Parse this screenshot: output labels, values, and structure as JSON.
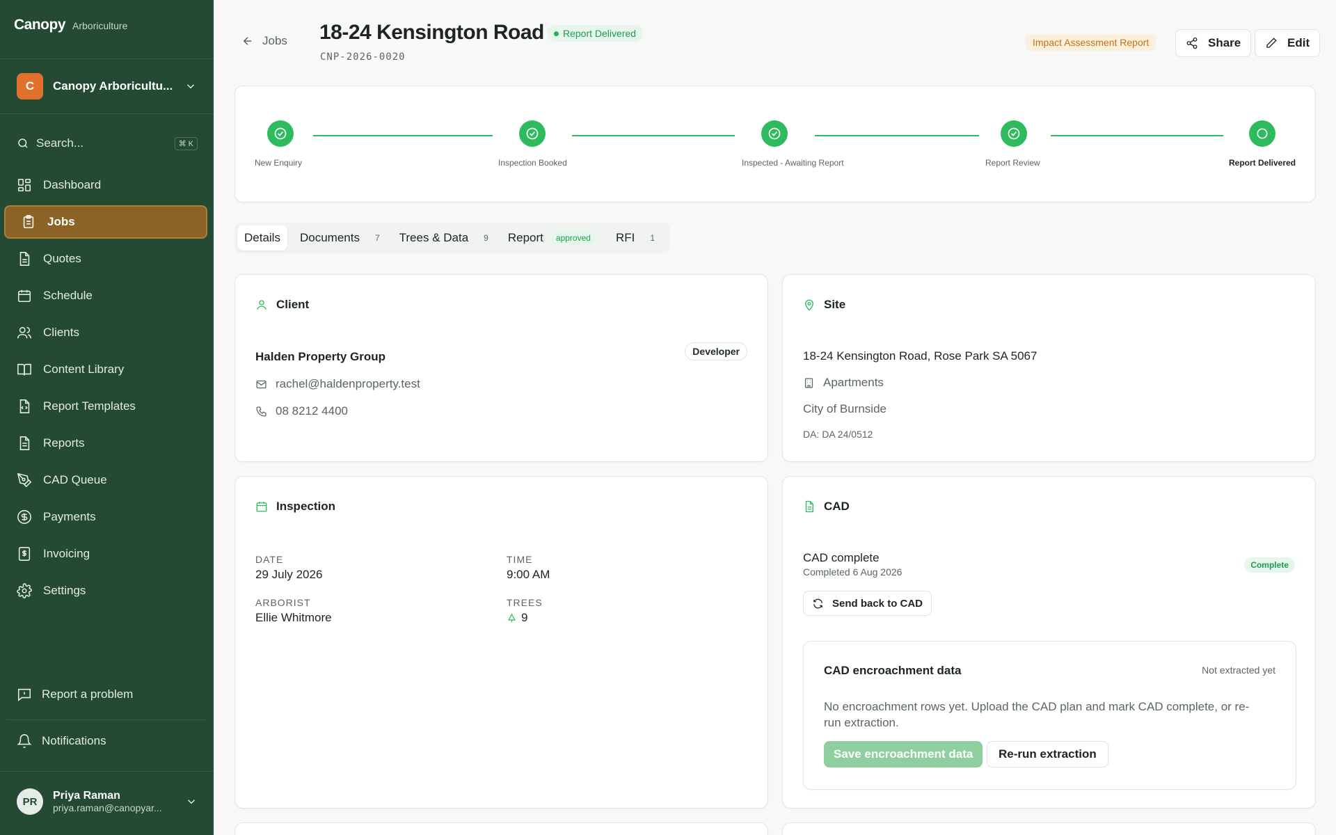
{
  "brand": {
    "name": "Canopy",
    "sub": "Arboriculture"
  },
  "org": {
    "initial": "C",
    "name": "Canopy Arboricultu..."
  },
  "search": {
    "placeholder": "Search...",
    "shortcut": "⌘ K"
  },
  "nav": [
    {
      "label": "Dashboard",
      "icon": "dashboard-icon"
    },
    {
      "label": "Jobs",
      "icon": "clipboard-icon"
    },
    {
      "label": "Quotes",
      "icon": "document-icon"
    },
    {
      "label": "Schedule",
      "icon": "calendar-icon"
    },
    {
      "label": "Clients",
      "icon": "users-icon"
    },
    {
      "label": "Content Library",
      "icon": "book-icon"
    },
    {
      "label": "Report Templates",
      "icon": "template-icon"
    },
    {
      "label": "Reports",
      "icon": "report-icon"
    },
    {
      "label": "CAD Queue",
      "icon": "pen-tool-icon"
    },
    {
      "label": "Payments",
      "icon": "dollar-icon"
    },
    {
      "label": "Invoicing",
      "icon": "invoice-icon"
    },
    {
      "label": "Settings",
      "icon": "gear-icon"
    }
  ],
  "active_nav": "Jobs",
  "footer": {
    "problem": "Report a problem",
    "notifications": "Notifications",
    "user": {
      "initials": "PR",
      "name": "Priya Raman",
      "email": "priya.raman@canopyar..."
    }
  },
  "header": {
    "back": "Jobs",
    "title": "18-24 Kensington Road",
    "status": "Report Delivered",
    "code": "CNP-2026-0020",
    "report_type": "Impact Assessment Report",
    "share": "Share",
    "edit": "Edit"
  },
  "steps": [
    {
      "label": "New Enquiry",
      "done": true
    },
    {
      "label": "Inspection Booked",
      "done": true
    },
    {
      "label": "Inspected - Awaiting Report",
      "done": true
    },
    {
      "label": "Report Review",
      "done": true
    },
    {
      "label": "Report Delivered",
      "done": false,
      "current": true
    }
  ],
  "tabs": [
    {
      "label": "Details"
    },
    {
      "label": "Documents",
      "count": "7"
    },
    {
      "label": "Trees & Data",
      "count": "9"
    },
    {
      "label": "Report",
      "badge": "approved"
    },
    {
      "label": "RFI",
      "count": "1"
    }
  ],
  "client": {
    "title": "Client",
    "name": "Halden Property Group",
    "role": "Developer",
    "email": "rachel@haldenproperty.test",
    "phone": "08 8212 4400"
  },
  "site": {
    "title": "Site",
    "address": "18-24 Kensington Road, Rose Park SA 5067",
    "type": "Apartments",
    "council": "City of Burnside",
    "da": "DA: DA 24/0512"
  },
  "inspection": {
    "title": "Inspection",
    "date_label": "DATE",
    "date": "29 July 2026",
    "time_label": "TIME",
    "time": "9:00 AM",
    "arborist_label": "ARBORIST",
    "arborist": "Ellie Whitmore",
    "trees_label": "TREES",
    "trees": "9"
  },
  "cad": {
    "title": "CAD",
    "status": "CAD complete",
    "completed": "Completed 6 Aug 2026",
    "badge": "Complete",
    "send_back": "Send back to CAD",
    "encroachment": {
      "title": "CAD encroachment data",
      "state": "Not extracted yet",
      "message_1": "No encroachment rows yet. Upload the CAD plan and mark CAD complete, or re-",
      "message_2": "run extraction.",
      "save": "Save encroachment data",
      "rerun": "Re-run extraction"
    }
  },
  "colors": {
    "sidebar": "#244a33",
    "accent_green": "#2dbb5d",
    "active_nav": "#8b6327",
    "orange": "#e0702a"
  }
}
